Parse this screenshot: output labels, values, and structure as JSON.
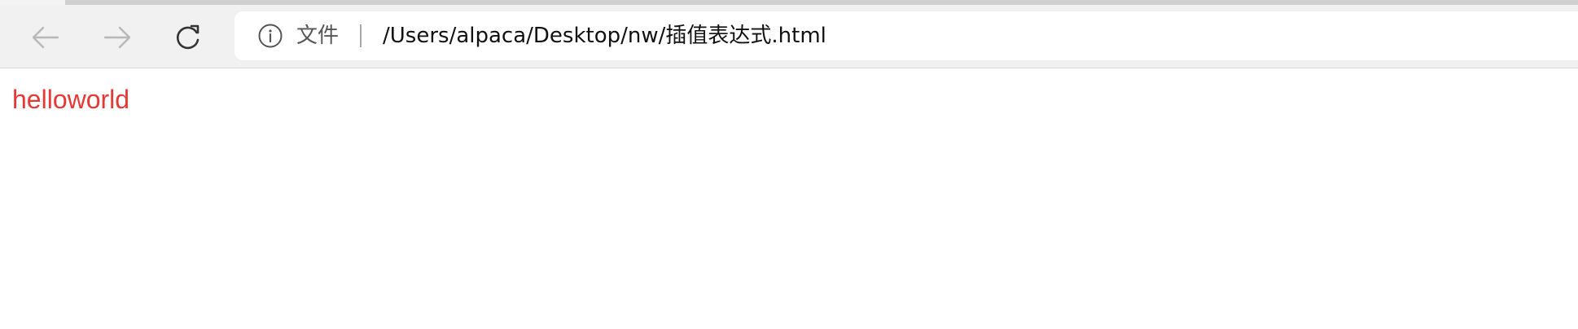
{
  "toolbar": {
    "back_icon": "arrow-left-icon",
    "forward_icon": "arrow-right-icon",
    "reload_icon": "reload-icon"
  },
  "omnibox": {
    "info_icon": "info-icon",
    "scheme_label": "文件",
    "url": "/Users/alpaca/Desktop/nw/插值表达式.html"
  },
  "page": {
    "text": "helloworld",
    "text_color": "#e53935"
  },
  "colors": {
    "toolbar_bg": "#f1f1f1",
    "omnibox_bg": "#ffffff",
    "disabled_icon": "#b8b8b8",
    "active_icon": "#333333"
  }
}
